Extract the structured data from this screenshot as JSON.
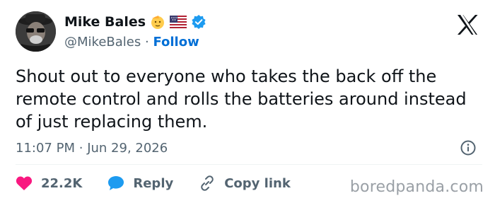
{
  "author": {
    "name": "Mike Bales",
    "handle": "@MikeBales",
    "separator": "·",
    "follow_label": "Follow",
    "avatar_icon": "avatar-photo",
    "badges": [
      "saluting-face-emoji",
      "us-flag-emoji",
      "verified-badge-icon"
    ],
    "verified_color": "#1d9bf0"
  },
  "platform_icon": "x-logo-icon",
  "tweet": {
    "text": "Shout out to everyone who takes the back off the remote control and rolls the batteries around instead of just replacing them.",
    "time": "11:07 PM",
    "separator": "·",
    "date": "Jun 29, 2026"
  },
  "actions": {
    "likes_count": "22.2K",
    "likes_icon": "heart-icon",
    "likes_color": "#f91880",
    "reply_label": "Reply",
    "reply_icon": "speech-bubble-icon",
    "reply_color": "#1d9bf0",
    "copy_link_label": "Copy link",
    "copy_link_icon": "link-icon"
  },
  "watermark": "boredpanda.com",
  "colors": {
    "text": "#0f1419",
    "muted": "#536471",
    "link": "#006fd6"
  }
}
